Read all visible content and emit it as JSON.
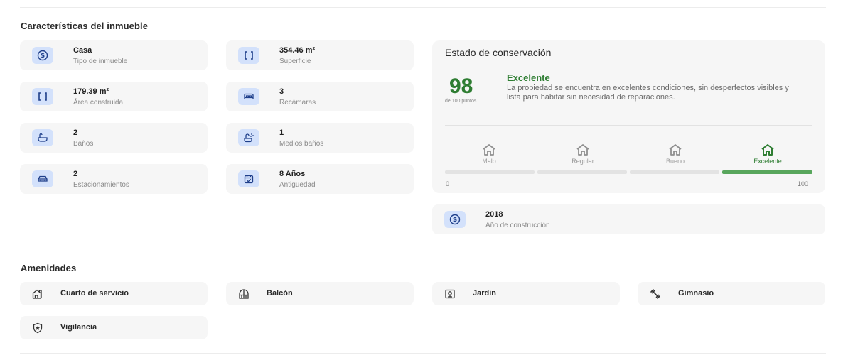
{
  "characteristics": {
    "title": "Características del inmueble",
    "items": [
      {
        "value": "Casa",
        "label": "Tipo de inmueble",
        "icon": "dollar-icon"
      },
      {
        "value": "354.46 m²",
        "label": "Superficie",
        "icon": "bracket-icon"
      },
      {
        "value": "179.39 m²",
        "label": "Área construida",
        "icon": "bracket-icon"
      },
      {
        "value": "3",
        "label": "Recámaras",
        "icon": "bed-icon"
      },
      {
        "value": "2",
        "label": "Baños",
        "icon": "bathtub-icon"
      },
      {
        "value": "1",
        "label": "Medios baños",
        "icon": "shower-icon"
      },
      {
        "value": "2",
        "label": "Estacionamientos",
        "icon": "car-icon"
      },
      {
        "value": "8 Años",
        "label": "Antigüedad",
        "icon": "calendar-icon"
      }
    ]
  },
  "conservation": {
    "title": "Estado de conservación",
    "score": "98",
    "score_caption": "de 100 puntos",
    "rating": "Excelente",
    "description": "La propiedad se encuentra en excelentes condiciones, sin desperfectos visibles y lista para habitar sin necesidad de reparaciones.",
    "levels": [
      "Malo",
      "Regular",
      "Bueno",
      "Excelente"
    ],
    "active_level": "Excelente",
    "scale_min": "0",
    "scale_max": "100",
    "progress_fraction": 0.98,
    "colors": {
      "accent": "#2e7d32",
      "bar": "#58a65c"
    }
  },
  "construction_year": {
    "value": "2018",
    "label": "Año de construcción",
    "icon": "dollar-icon"
  },
  "amenities": {
    "title": "Amenidades",
    "items": [
      {
        "label": "Cuarto de servicio",
        "icon": "house-room-icon"
      },
      {
        "label": "Balcón",
        "icon": "balcony-icon"
      },
      {
        "label": "Jardín",
        "icon": "garden-icon"
      },
      {
        "label": "Gimnasio",
        "icon": "dumbbell-icon"
      },
      {
        "label": "Vigilancia",
        "icon": "shield-star-icon"
      }
    ]
  },
  "colors": {
    "icon_bg": "#d3e1fb",
    "icon_fg": "#1f3f8a",
    "card_bg": "#f6f6f6"
  }
}
